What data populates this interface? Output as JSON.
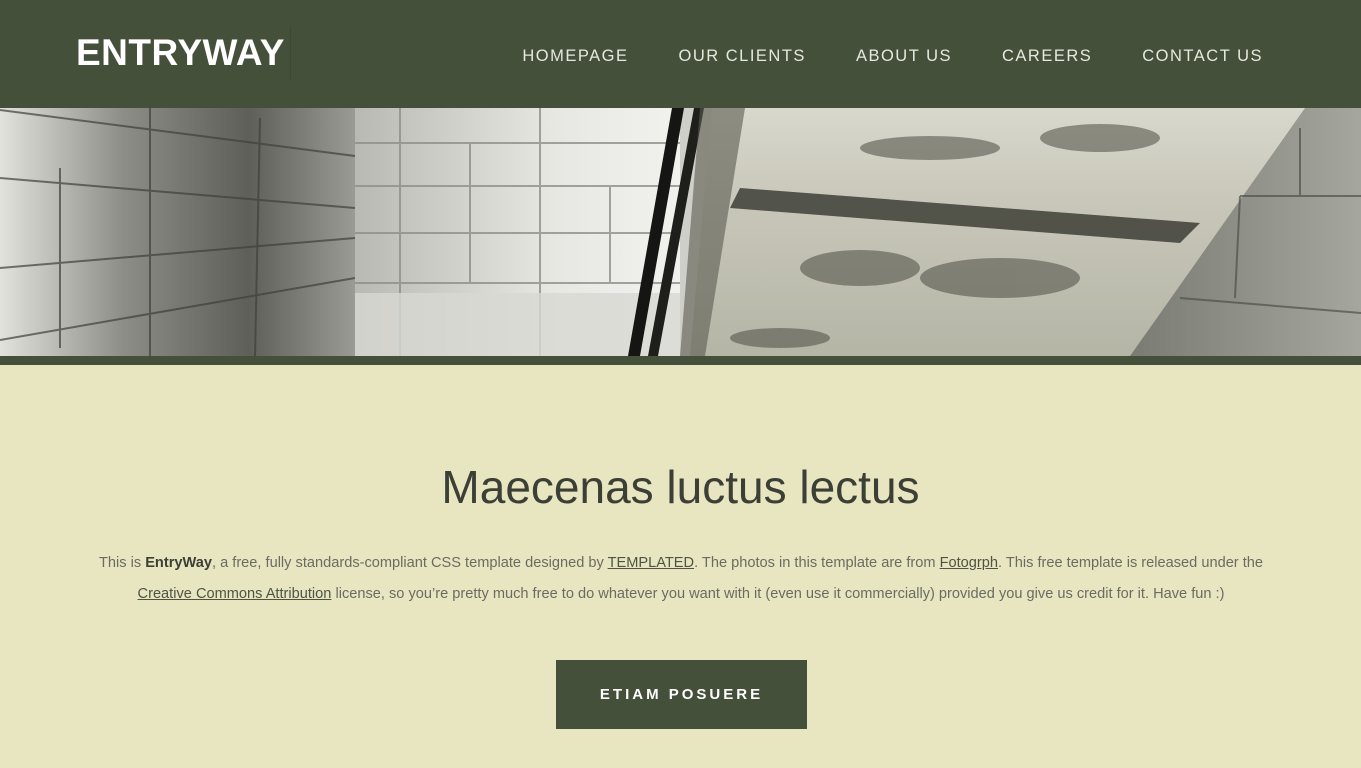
{
  "header": {
    "logo": "ENTRYWAY",
    "nav": [
      "HOMEPAGE",
      "OUR CLIENTS",
      "ABOUT US",
      "CAREERS",
      "CONTACT US"
    ]
  },
  "main": {
    "title": "Maecenas luctus lectus",
    "intro": {
      "t1": "This is ",
      "brand": "EntryWay",
      "t2": ", a free, fully standards-compliant CSS template designed by ",
      "link1": "TEMPLATED",
      "t3": ". The photos in this template are from ",
      "link2": "Fotogrph",
      "t4": ". This free template is released under the ",
      "link3": "Creative Commons Attribution",
      "t5": " license, so you’re pretty much free to do whatever you want with it (even use it commercially) provided you give us credit for it. Have fun :)"
    },
    "button": "ETIAM POSUERE"
  },
  "colors": {
    "header_bg": "#45503b",
    "page_bg": "#e8e5c1",
    "text": "#3b3f36"
  }
}
